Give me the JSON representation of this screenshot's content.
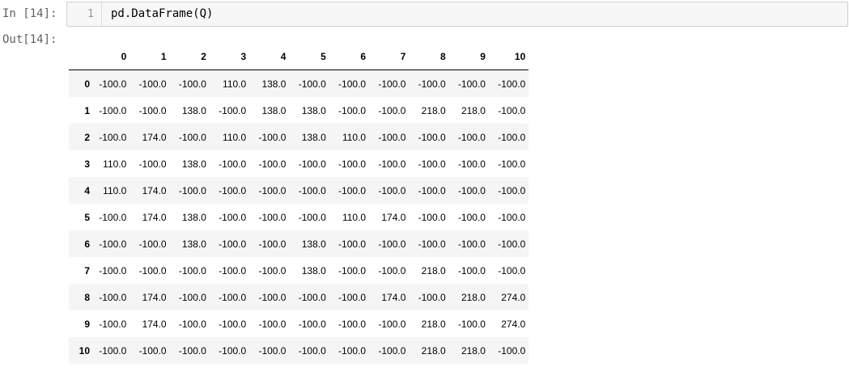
{
  "cell": {
    "in_prompt": "In [14]:",
    "out_prompt": "Out[14]:",
    "line_number": "1",
    "code": "pd.DataFrame(Q)"
  },
  "dataframe": {
    "columns": [
      "0",
      "1",
      "2",
      "3",
      "4",
      "5",
      "6",
      "7",
      "8",
      "9",
      "10"
    ],
    "index": [
      "0",
      "1",
      "2",
      "3",
      "4",
      "5",
      "6",
      "7",
      "8",
      "9",
      "10"
    ],
    "rows": [
      [
        "-100.0",
        "-100.0",
        "-100.0",
        "110.0",
        "138.0",
        "-100.0",
        "-100.0",
        "-100.0",
        "-100.0",
        "-100.0",
        "-100.0"
      ],
      [
        "-100.0",
        "-100.0",
        "138.0",
        "-100.0",
        "138.0",
        "138.0",
        "-100.0",
        "-100.0",
        "218.0",
        "218.0",
        "-100.0"
      ],
      [
        "-100.0",
        "174.0",
        "-100.0",
        "110.0",
        "-100.0",
        "138.0",
        "110.0",
        "-100.0",
        "-100.0",
        "-100.0",
        "-100.0"
      ],
      [
        "110.0",
        "-100.0",
        "138.0",
        "-100.0",
        "-100.0",
        "-100.0",
        "-100.0",
        "-100.0",
        "-100.0",
        "-100.0",
        "-100.0"
      ],
      [
        "110.0",
        "174.0",
        "-100.0",
        "-100.0",
        "-100.0",
        "-100.0",
        "-100.0",
        "-100.0",
        "-100.0",
        "-100.0",
        "-100.0"
      ],
      [
        "-100.0",
        "174.0",
        "138.0",
        "-100.0",
        "-100.0",
        "-100.0",
        "110.0",
        "174.0",
        "-100.0",
        "-100.0",
        "-100.0"
      ],
      [
        "-100.0",
        "-100.0",
        "138.0",
        "-100.0",
        "-100.0",
        "138.0",
        "-100.0",
        "-100.0",
        "-100.0",
        "-100.0",
        "-100.0"
      ],
      [
        "-100.0",
        "-100.0",
        "-100.0",
        "-100.0",
        "-100.0",
        "138.0",
        "-100.0",
        "-100.0",
        "218.0",
        "-100.0",
        "-100.0"
      ],
      [
        "-100.0",
        "174.0",
        "-100.0",
        "-100.0",
        "-100.0",
        "-100.0",
        "-100.0",
        "174.0",
        "-100.0",
        "218.0",
        "274.0"
      ],
      [
        "-100.0",
        "174.0",
        "-100.0",
        "-100.0",
        "-100.0",
        "-100.0",
        "-100.0",
        "-100.0",
        "218.0",
        "-100.0",
        "274.0"
      ],
      [
        "-100.0",
        "-100.0",
        "-100.0",
        "-100.0",
        "-100.0",
        "-100.0",
        "-100.0",
        "-100.0",
        "218.0",
        "218.0",
        "-100.0"
      ]
    ]
  }
}
